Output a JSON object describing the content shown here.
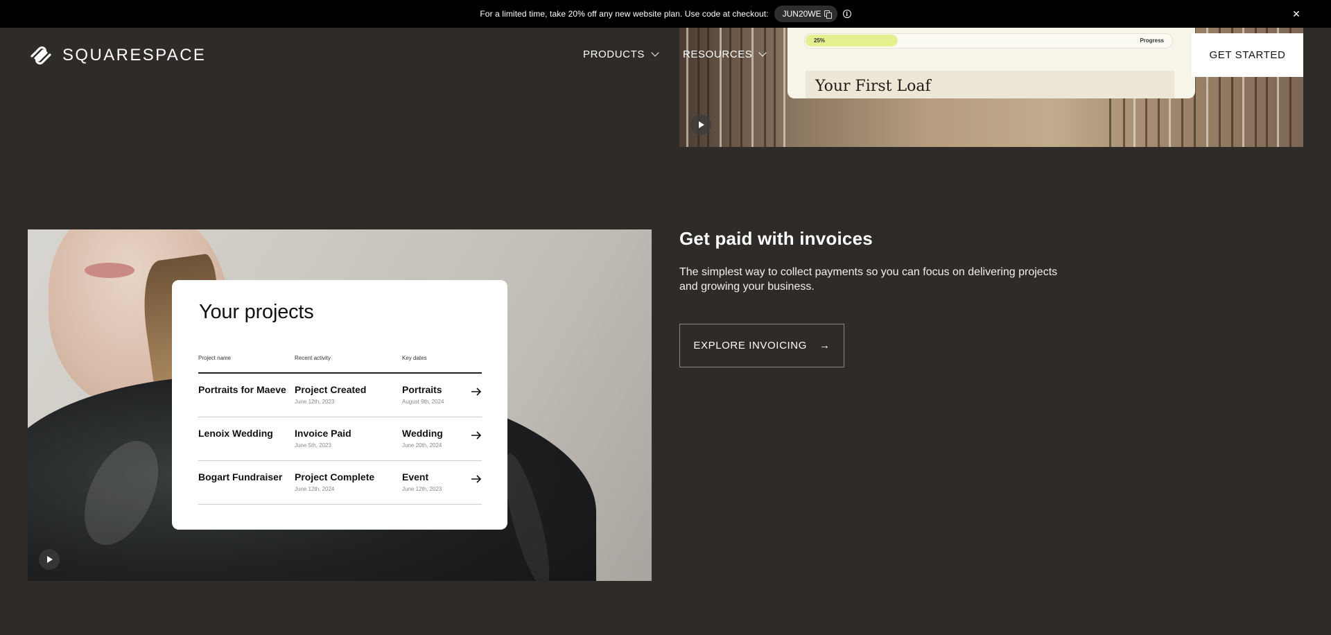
{
  "promo": {
    "text": "For a limited time, take 20% off any new website plan. Use code at checkout:",
    "code": "JUN20WE",
    "close_glyph": "✕"
  },
  "header": {
    "logo_text": "SQUARESPACE",
    "nav": [
      {
        "label": "PRODUCTS"
      },
      {
        "label": "RESOURCES"
      }
    ],
    "cta_label": "GET STARTED"
  },
  "top_media": {
    "progress_percent": "25%",
    "progress_value": 0.25,
    "progress_label": "Progress",
    "card_title": "Your First Loaf"
  },
  "invoice_section": {
    "title": "Get paid with invoices",
    "description": "The simplest way to collect payments so you can focus on delivering projects and growing your business.",
    "button_label": "EXPLORE INVOICING",
    "button_arrow": "→"
  },
  "projects_card": {
    "title": "Your projects",
    "columns": [
      "Project name",
      "Recent activity",
      "Key dates"
    ],
    "rows": [
      {
        "name": "Portraits for Maeve",
        "activity": "Project Created",
        "activity_date": "June 12th, 2023",
        "key": "Portraits",
        "key_date": "August 9th, 2024"
      },
      {
        "name": "Lenoix Wedding",
        "activity": "Invoice Paid",
        "activity_date": "June 5th, 2023",
        "key": "Wedding",
        "key_date": "June 20th, 2024"
      },
      {
        "name": "Bogart Fundraiser",
        "activity": "Project Complete",
        "activity_date": "June 12th, 2024",
        "key": "Event",
        "key_date": "June 12th, 2023"
      }
    ]
  },
  "icons": [
    "squarespace-logo-icon",
    "copy-icon",
    "info-icon",
    "close-icon",
    "chevron-down-icon",
    "play-icon",
    "arrow-right-icon"
  ]
}
